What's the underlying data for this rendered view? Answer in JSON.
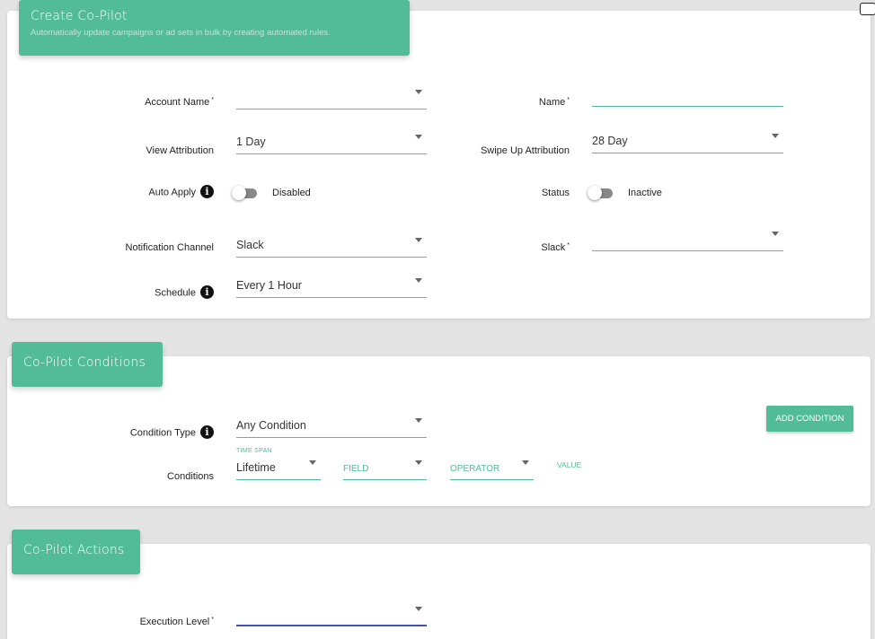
{
  "create": {
    "title": "Create Co-Pilot",
    "subtitle": "Automatically update campaigns or ad sets in bulk by creating automated rules.",
    "account_name_label": "Account Name",
    "account_name_value": "",
    "name_label": "Name",
    "name_value": "",
    "view_attribution_label": "View Attribution",
    "view_attribution_value": "1 Day",
    "swipe_up_label": "Swipe Up Attribution",
    "swipe_up_value": "28 Day",
    "auto_apply_label": "Auto Apply",
    "auto_apply_state": "Disabled",
    "status_label": "Status",
    "status_state": "Inactive",
    "notification_channel_label": "Notification Channel",
    "notification_channel_value": "Slack",
    "slack_label": "Slack",
    "slack_value": "",
    "schedule_label": "Schedule",
    "schedule_value": "Every 1 Hour",
    "required_mark": "*",
    "info_glyph": "i"
  },
  "conditions": {
    "title": "Co-Pilot Conditions",
    "condition_type_label": "Condition Type",
    "condition_type_value": "Any Condition",
    "add_condition_label": "ADD CONDITION",
    "conditions_label": "Conditions",
    "time_span_label": "TIME SPAN",
    "time_span_value": "Lifetime",
    "field_placeholder": "FIELD",
    "operator_placeholder": "OPERATOR",
    "value_label": "VALUE"
  },
  "actions": {
    "title": "Co-Pilot Actions",
    "execution_level_label": "Execution Level",
    "execution_level_value": ""
  },
  "theme": {
    "accent": "#52bc98",
    "focus": "#3f51b5",
    "background": "#e4e4e4"
  }
}
